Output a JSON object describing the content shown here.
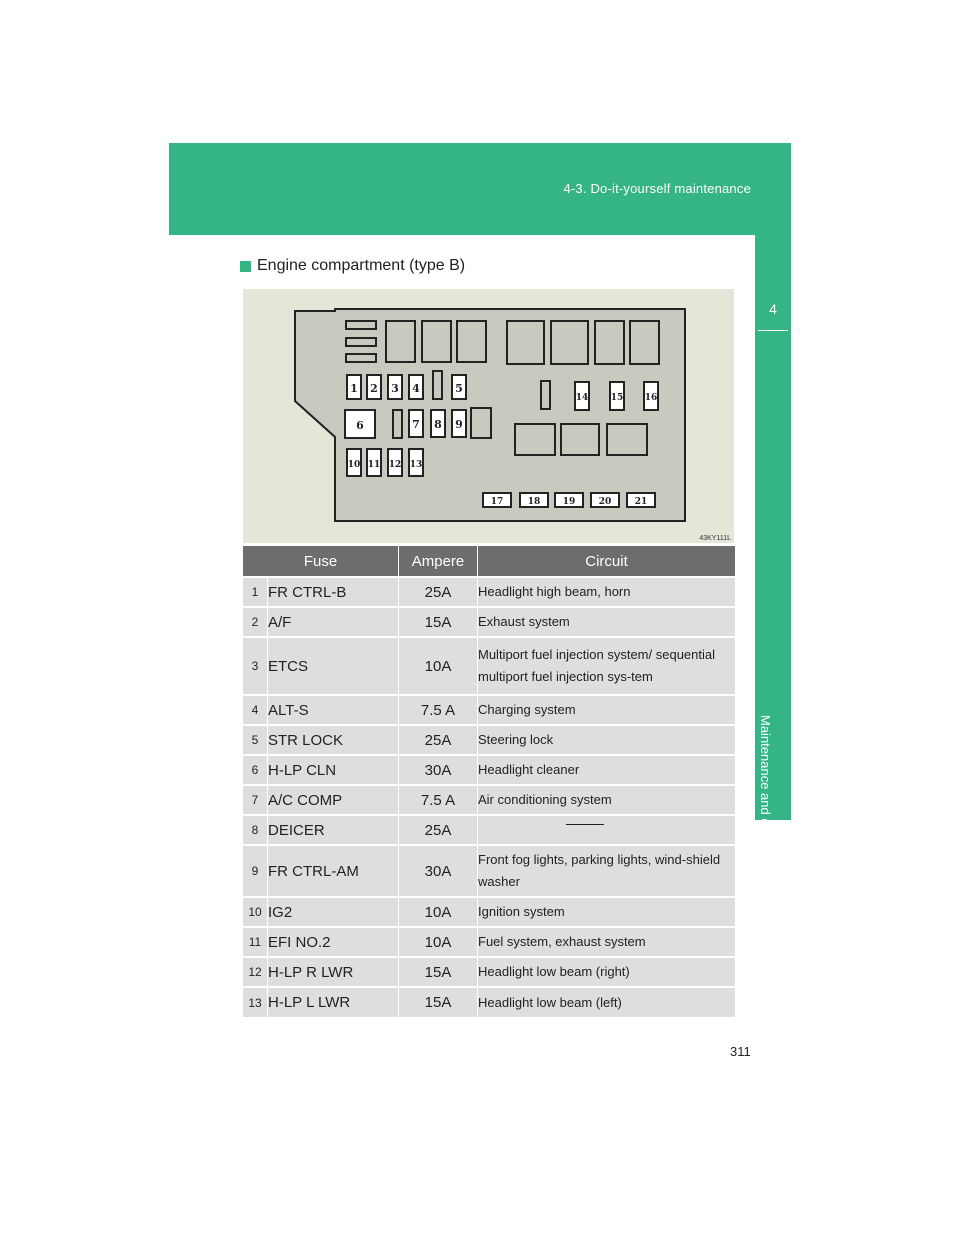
{
  "header": {
    "section": "4-3. Do-it-yourself maintenance"
  },
  "side_tab": {
    "number": "4",
    "label": "Maintenance and care"
  },
  "heading": "Engine compartment (type B)",
  "diagram": {
    "code": "43KY111L",
    "labels": [
      "1",
      "2",
      "3",
      "4",
      "5",
      "6",
      "7",
      "8",
      "9",
      "10",
      "11",
      "12",
      "13",
      "14",
      "15",
      "16",
      "17",
      "18",
      "19",
      "20",
      "21"
    ]
  },
  "table": {
    "headers": {
      "fuse": "Fuse",
      "ampere": "Ampere",
      "circuit": "Circuit"
    },
    "rows": [
      {
        "num": "1",
        "fuse": "FR CTRL-B",
        "ampere": "25A",
        "circuit": "Headlight high beam, horn"
      },
      {
        "num": "2",
        "fuse": "A/F",
        "ampere": "15A",
        "circuit": "Exhaust system"
      },
      {
        "num": "3",
        "fuse": "ETCS",
        "ampere": "10A",
        "circuit": "Multiport fuel injection system/ sequential multiport fuel injection sys-tem"
      },
      {
        "num": "4",
        "fuse": "ALT-S",
        "ampere": "7.5 A",
        "circuit": "Charging system"
      },
      {
        "num": "5",
        "fuse": "STR LOCK",
        "ampere": "25A",
        "circuit": "Steering lock"
      },
      {
        "num": "6",
        "fuse": "H-LP CLN",
        "ampere": "30A",
        "circuit": "Headlight cleaner"
      },
      {
        "num": "7",
        "fuse": "A/C COMP",
        "ampere": "7.5 A",
        "circuit": "Air conditioning system"
      },
      {
        "num": "8",
        "fuse": "DEICER",
        "ampere": "25A",
        "circuit": ""
      },
      {
        "num": "9",
        "fuse": "FR CTRL-AM",
        "ampere": "30A",
        "circuit": "Front fog lights, parking lights, wind-shield washer"
      },
      {
        "num": "10",
        "fuse": "IG2",
        "ampere": "10A",
        "circuit": "Ignition system"
      },
      {
        "num": "11",
        "fuse": "EFI NO.2",
        "ampere": "10A",
        "circuit": "Fuel system, exhaust system"
      },
      {
        "num": "12",
        "fuse": "H-LP R LWR",
        "ampere": "15A",
        "circuit": "Headlight low beam (right)"
      },
      {
        "num": "13",
        "fuse": "H-LP L LWR",
        "ampere": "15A",
        "circuit": "Headlight low beam (left)"
      }
    ]
  },
  "page_number": "311",
  "colors": {
    "accent": "#35b585",
    "header_row": "#6d6d6d",
    "row_bg": "#dedede"
  }
}
